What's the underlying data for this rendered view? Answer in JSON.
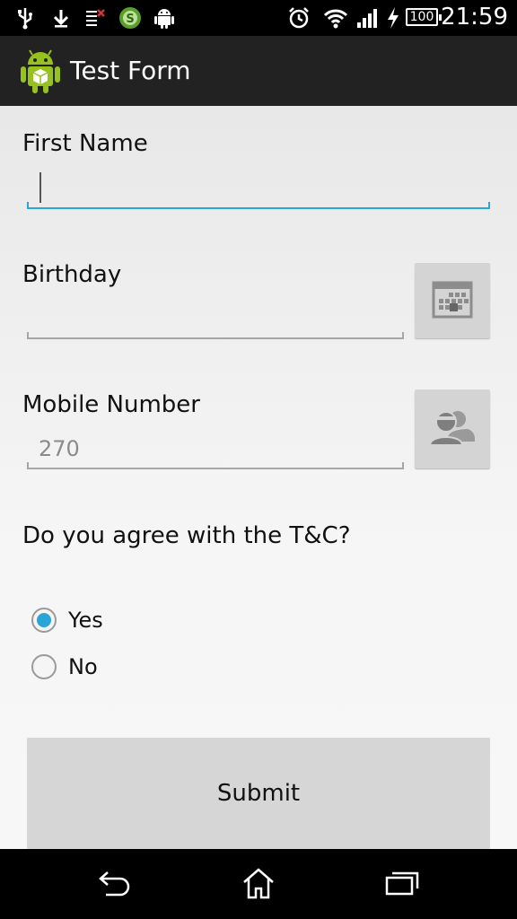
{
  "status_bar": {
    "time": "21:59",
    "battery_level": "100",
    "icons": [
      "usb-icon",
      "download-icon",
      "sim-icon",
      "s-app-icon",
      "android-icon",
      "alarm-icon",
      "wifi-icon",
      "signal-icon",
      "charging-icon"
    ]
  },
  "action_bar": {
    "title": "Test Form",
    "app_icon": "android-app-icon"
  },
  "form": {
    "first_name_label": "First Name",
    "first_name_value": "",
    "birthday_label": "Birthday",
    "birthday_value": "",
    "mobile_label": "Mobile Number",
    "mobile_value": "270",
    "question": "Do you agree with the T&C?",
    "options": [
      {
        "label": "Yes",
        "checked": true
      },
      {
        "label": "No",
        "checked": false
      }
    ],
    "submit_label": "Submit"
  },
  "colors": {
    "accent": "#2aa6d6",
    "action_bar": "#222222",
    "button_bg": "#d6d6d6"
  },
  "nav_bar": {
    "icons": [
      "back-icon",
      "home-icon",
      "recents-icon"
    ]
  }
}
